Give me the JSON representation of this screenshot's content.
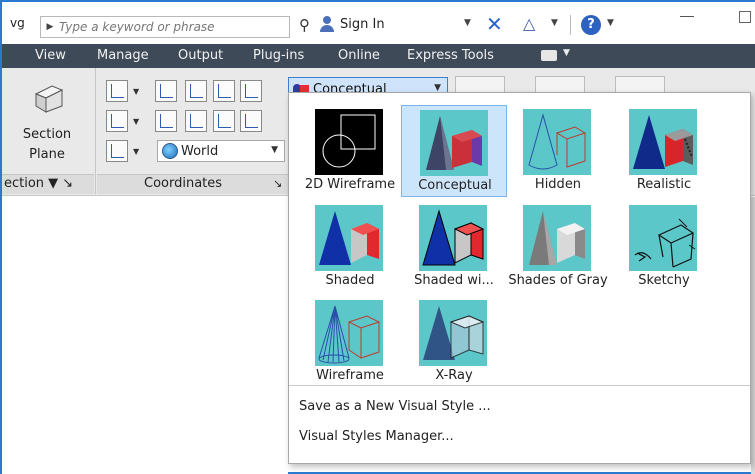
{
  "titlebar": {
    "doc_fragment": "vg",
    "search_placeholder": "Type a keyword or phrase",
    "sign_in": "Sign In"
  },
  "menubar": {
    "items": [
      "View",
      "Manage",
      "Output",
      "Plug-ins",
      "Online",
      "Express Tools"
    ]
  },
  "ribbon": {
    "section_label_line1": "Section",
    "section_label_line2": "Plane",
    "section_panel_title": "ection ▼ ↘",
    "coordinates_panel_title": "Coordinates",
    "coordinates_panel_launcher": "↘",
    "ucs_value": "World",
    "visual_style_current": "Conceptual"
  },
  "gallery": {
    "styles": [
      {
        "label": "2D Wireframe",
        "selected": false
      },
      {
        "label": "Conceptual",
        "selected": true
      },
      {
        "label": "Hidden",
        "selected": false
      },
      {
        "label": "Realistic",
        "selected": false
      },
      {
        "label": "Shaded",
        "selected": false
      },
      {
        "label": "Shaded wi...",
        "selected": false
      },
      {
        "label": "Shades of Gray",
        "selected": false
      },
      {
        "label": "Sketchy",
        "selected": false
      },
      {
        "label": "Wireframe",
        "selected": false
      },
      {
        "label": "X-Ray",
        "selected": false
      }
    ],
    "commands": [
      "Save as a New Visual Style ...",
      "Visual Styles Manager..."
    ]
  },
  "colors": {
    "accent": "#2b7ad2",
    "menubar_bg": "#3f4a59",
    "thumb_bg": "#5bc7c9",
    "selected_bg": "#cde5fb"
  }
}
